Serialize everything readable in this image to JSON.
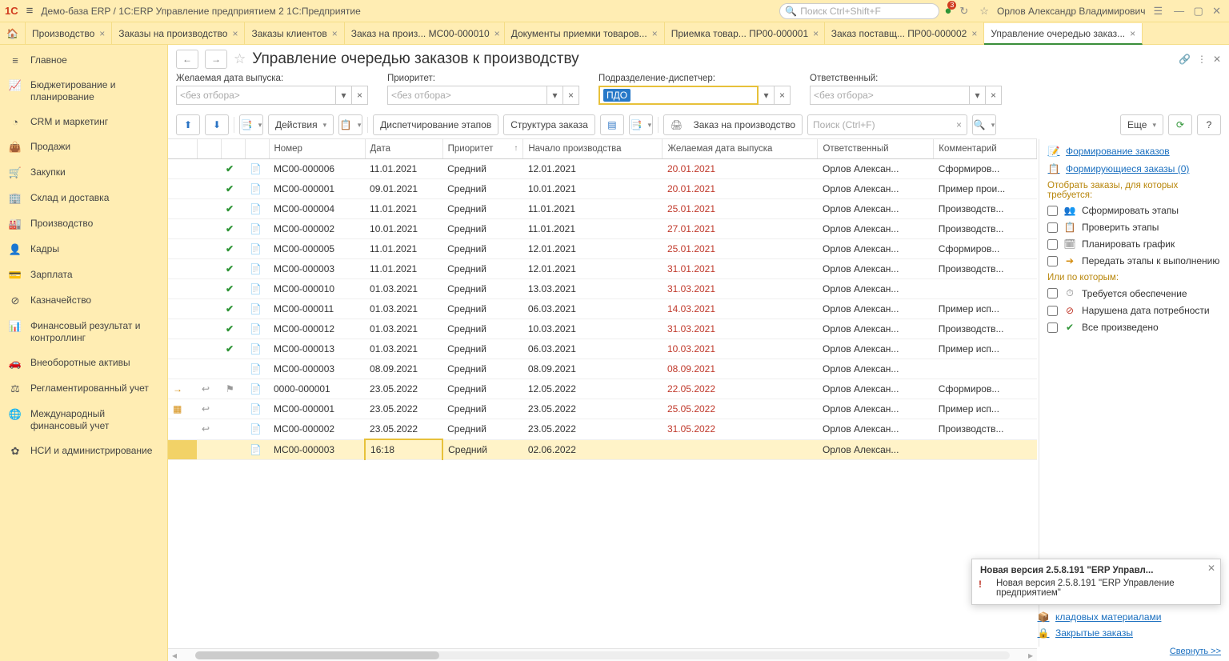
{
  "titlebar": {
    "logo": "1С",
    "appTitle": "Демо-база ERP / 1С:ERP Управление предприятием 2 1С:Предприятие",
    "searchPlaceholder": "Поиск Ctrl+Shift+F",
    "badgeCount": "3",
    "userName": "Орлов Александр Владимирович"
  },
  "tabs": [
    {
      "label": "Производство",
      "close": true
    },
    {
      "label": "Заказы на производство",
      "close": true
    },
    {
      "label": "Заказы клиентов",
      "close": true
    },
    {
      "label": "Заказ на произ... МС00-000010",
      "close": true
    },
    {
      "label": "Документы приемки товаров...",
      "close": true
    },
    {
      "label": "Приемка товар... ПР00-000001",
      "close": true
    },
    {
      "label": "Заказ поставщ... ПР00-000002",
      "close": true
    },
    {
      "label": "Управление очередью заказ...",
      "close": true,
      "active": true
    }
  ],
  "sidebar": [
    {
      "icon": "≡",
      "label": "Главное"
    },
    {
      "icon": "📈",
      "label": "Бюджетирование и планирование"
    },
    {
      "icon": "◔",
      "label": "CRM и маркетинг"
    },
    {
      "icon": "👜",
      "label": "Продажи"
    },
    {
      "icon": "🛒",
      "label": "Закупки"
    },
    {
      "icon": "🏢",
      "label": "Склад и доставка"
    },
    {
      "icon": "🏭",
      "label": "Производство"
    },
    {
      "icon": "👤",
      "label": "Кадры"
    },
    {
      "icon": "💳",
      "label": "Зарплата"
    },
    {
      "icon": "⊘",
      "label": "Казначейство"
    },
    {
      "icon": "📊",
      "label": "Финансовый результат и контроллинг"
    },
    {
      "icon": "🚗",
      "label": "Внеоборотные активы"
    },
    {
      "icon": "⚖",
      "label": "Регламентированный учет"
    },
    {
      "icon": "🌐",
      "label": "Международный финансовый учет"
    },
    {
      "icon": "✿",
      "label": "НСИ и администрирование"
    }
  ],
  "page": {
    "title": "Управление очередью заказов к производству"
  },
  "filters": {
    "f1": {
      "label": "Желаемая дата выпуска:",
      "placeholder": "<без отбора>"
    },
    "f2": {
      "label": "Приоритет:",
      "placeholder": "<без отбора>"
    },
    "f3": {
      "label": "Подразделение-диспетчер:",
      "value": "ПДО"
    },
    "f4": {
      "label": "Ответственный:",
      "placeholder": "<без отбора>"
    }
  },
  "toolbar": {
    "actions": "Действия",
    "dispatch": "Диспетчирование этапов",
    "structure": "Структура заказа",
    "order": "Заказ на производство",
    "searchPlaceholder": "Поиск (Ctrl+F)",
    "more": "Еще"
  },
  "columns": [
    "",
    "",
    "",
    "",
    "Номер",
    "Дата",
    "Приоритет",
    "Начало производства",
    "Желаемая дата выпуска",
    "Ответственный",
    "Комментарий"
  ],
  "rows": [
    {
      "st": "",
      "a": "",
      "b": "✔",
      "c": "📄",
      "num": "МС00-000006",
      "date": "11.01.2021",
      "prio": "Средний",
      "start": "12.01.2021",
      "due": "20.01.2021",
      "resp": "Орлов Алексан...",
      "comm": "Сформиров..."
    },
    {
      "st": "",
      "a": "",
      "b": "✔",
      "c": "📄",
      "num": "МС00-000001",
      "date": "09.01.2021",
      "prio": "Средний",
      "start": "10.01.2021",
      "due": "20.01.2021",
      "resp": "Орлов Алексан...",
      "comm": "Пример прои..."
    },
    {
      "st": "",
      "a": "",
      "b": "✔",
      "c": "📄",
      "num": "МС00-000004",
      "date": "11.01.2021",
      "prio": "Средний",
      "start": "11.01.2021",
      "due": "25.01.2021",
      "resp": "Орлов Алексан...",
      "comm": "Производств..."
    },
    {
      "st": "",
      "a": "",
      "b": "✔",
      "c": "📄",
      "num": "МС00-000002",
      "date": "10.01.2021",
      "prio": "Средний",
      "start": "11.01.2021",
      "due": "27.01.2021",
      "resp": "Орлов Алексан...",
      "comm": "Производств..."
    },
    {
      "st": "",
      "a": "",
      "b": "✔",
      "c": "📄",
      "num": "МС00-000005",
      "date": "11.01.2021",
      "prio": "Средний",
      "start": "12.01.2021",
      "due": "25.01.2021",
      "resp": "Орлов Алексан...",
      "comm": "Сформиров..."
    },
    {
      "st": "",
      "a": "",
      "b": "✔",
      "c": "📄",
      "num": "МС00-000003",
      "date": "11.01.2021",
      "prio": "Средний",
      "start": "12.01.2021",
      "due": "31.01.2021",
      "resp": "Орлов Алексан...",
      "comm": "Производств..."
    },
    {
      "st": "",
      "a": "",
      "b": "✔",
      "c": "📄",
      "num": "МС00-000010",
      "date": "01.03.2021",
      "prio": "Средний",
      "start": "13.03.2021",
      "due": "31.03.2021",
      "resp": "Орлов Алексан...",
      "comm": ""
    },
    {
      "st": "",
      "a": "",
      "b": "✔",
      "c": "📄",
      "num": "МС00-000011",
      "date": "01.03.2021",
      "prio": "Средний",
      "start": "06.03.2021",
      "due": "14.03.2021",
      "resp": "Орлов Алексан...",
      "comm": "Пример исп..."
    },
    {
      "st": "",
      "a": "",
      "b": "✔",
      "c": "📄",
      "num": "МС00-000012",
      "date": "01.03.2021",
      "prio": "Средний",
      "start": "10.03.2021",
      "due": "31.03.2021",
      "resp": "Орлов Алексан...",
      "comm": "Производств..."
    },
    {
      "st": "",
      "a": "",
      "b": "✔",
      "c": "📄",
      "num": "МС00-000013",
      "date": "01.03.2021",
      "prio": "Средний",
      "start": "06.03.2021",
      "due": "10.03.2021",
      "resp": "Орлов Алексан...",
      "comm": "Пример исп..."
    },
    {
      "st": "",
      "a": "",
      "b": "",
      "c": "📄",
      "num": "МС00-000003",
      "date": "08.09.2021",
      "prio": "Средний",
      "start": "08.09.2021",
      "due": "08.09.2021",
      "resp": "Орлов Алексан...",
      "comm": ""
    },
    {
      "st": "→",
      "a": "↩",
      "b": "⚑",
      "c": "📄",
      "num": "0000-000001",
      "date": "23.05.2022",
      "prio": "Средний",
      "start": "12.05.2022",
      "due": "22.05.2022",
      "resp": "Орлов Алексан...",
      "comm": "Сформиров..."
    },
    {
      "st": "▦",
      "a": "↩",
      "b": "",
      "c": "📄",
      "num": "МС00-000001",
      "date": "23.05.2022",
      "prio": "Средний",
      "start": "23.05.2022",
      "due": "25.05.2022",
      "resp": "Орлов Алексан...",
      "comm": "Пример исп..."
    },
    {
      "st": "",
      "a": "↩",
      "b": "",
      "c": "📄",
      "num": "МС00-000002",
      "date": "23.05.2022",
      "prio": "Средний",
      "start": "23.05.2022",
      "due": "31.05.2022",
      "resp": "Орлов Алексан...",
      "comm": "Производств..."
    },
    {
      "st": "",
      "a": "",
      "b": "",
      "c": "📄",
      "num": "МС00-000003",
      "date": "16:18",
      "prio": "Средний",
      "start": "02.06.2022",
      "due": "",
      "resp": "Орлов Алексан...",
      "comm": "",
      "sel": true,
      "editing": true
    }
  ],
  "sidepanel": {
    "link1": "Формирование заказов",
    "link2": "Формирующиеся заказы (0)",
    "head1": "Отобрать заказы, для которых требуется:",
    "items1": [
      {
        "ic": "👥",
        "label": "Сформировать этапы"
      },
      {
        "ic": "📋",
        "label": "Проверить этапы"
      },
      {
        "ic": "🗓",
        "label": "Планировать график"
      },
      {
        "ic": "➔",
        "cls": "orange",
        "label": "Передать этапы к выполнению"
      }
    ],
    "head2": "Или по которым:",
    "items2": [
      {
        "ic": "⏱",
        "label": "Требуется обеспечение"
      },
      {
        "ic": "⊘",
        "cls": "red",
        "label": "Нарушена дата потребности"
      },
      {
        "ic": "✔",
        "cls": "green",
        "label": "Все произведено"
      }
    ]
  },
  "bottomLinks": [
    {
      "ic": "📦",
      "label": "кладовых материалами"
    },
    {
      "ic": "🔒",
      "label": "Закрытые заказы"
    }
  ],
  "collapse": "Свернуть >>",
  "popup": {
    "title": "Новая версия 2.5.8.191 \"ERP Управл...",
    "body": "Новая версия 2.5.8.191 \"ERP Управление предприятием\""
  }
}
